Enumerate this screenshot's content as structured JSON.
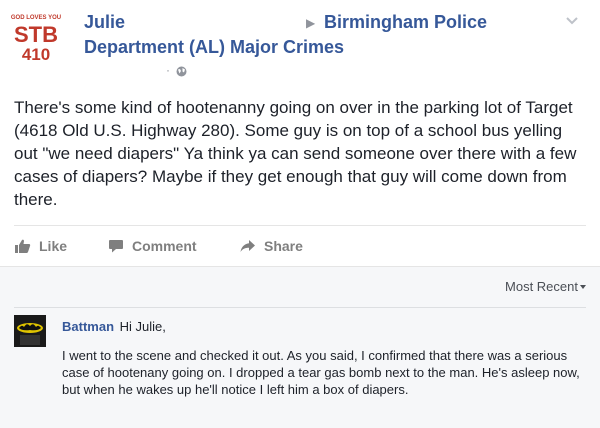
{
  "post": {
    "author": "Julie",
    "target_line1": "Birmingham Police",
    "target_line2": "Department (AL) Major Crimes",
    "meta_separator": "·",
    "body": "There's some kind of hootenanny going on over in the parking lot of Target (4618 Old U.S. Highway 280). Some guy is on top of a school bus yelling out \"we need diapers\" Ya think ya can send someone over there with a few cases of diapers? Maybe if they get enough that guy will come down from there.",
    "avatar_lines": [
      "GOD LOVES YOU",
      "STB",
      "410"
    ],
    "icons": [
      "chevron-down-icon",
      "globe-icon",
      "like-icon",
      "comment-icon",
      "share-icon"
    ]
  },
  "actions": {
    "like": "Like",
    "comment": "Comment",
    "share": "Share"
  },
  "comments": {
    "sort_label": "Most Recent",
    "items": [
      {
        "author": "Battman",
        "greeting": "Hi Julie,",
        "text": "I went to the scene and checked it out. As you said, I confirmed that there was a serious case of hootenany going on. I dropped a tear gas bomb next to the man. He's asleep now, but when he wakes up he'll notice I left him a box of diapers."
      }
    ]
  },
  "colors": {
    "link": "#365899",
    "muted": "#90949c",
    "action": "#7f7f7f",
    "comment_bg": "#f6f7f9"
  }
}
